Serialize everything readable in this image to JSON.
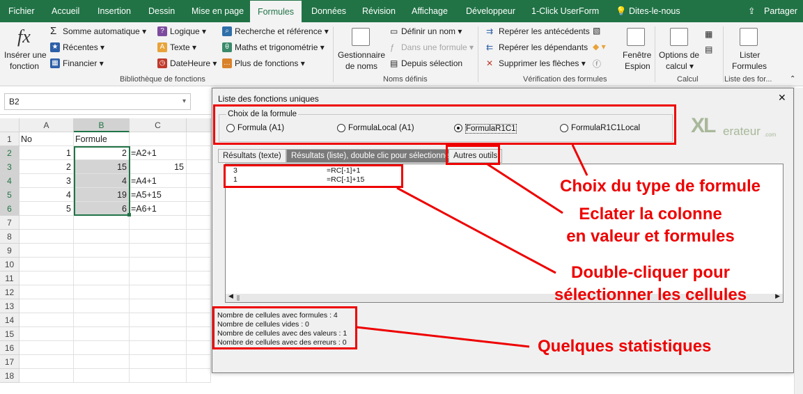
{
  "menu": {
    "tabs": [
      "Fichier",
      "Accueil",
      "Insertion",
      "Dessin",
      "Mise en page",
      "Formules",
      "Données",
      "Révision",
      "Affichage",
      "Développeur",
      "1-Click UserForm"
    ],
    "active_tab": "Formules",
    "search": "Dites-le-nous",
    "share": "Partager"
  },
  "ribbon": {
    "insert_function": [
      "Insérer une",
      "fonction"
    ],
    "library": [
      "Somme automatique",
      "Récentes",
      "Financier",
      "Logique",
      "Texte",
      "DateHeure",
      "Recherche et référence",
      "Maths et trigonométrie",
      "Plus de fonctions"
    ],
    "library_label": "Bibliothèque de fonctions",
    "name_manager": [
      "Gestionnaire",
      "de noms"
    ],
    "names": [
      "Définir un nom",
      "Dans une formule",
      "Depuis sélection"
    ],
    "names_label": "Noms définis",
    "audit": [
      "Repérer les antécédents",
      "Repérer les dépendants",
      "Supprimer les flèches"
    ],
    "watch": [
      "Fenêtre",
      "Espion"
    ],
    "audit_label": "Vérification des formules",
    "calc_options": [
      "Options de",
      "calcul"
    ],
    "calc_label": "Calcul",
    "list_formulas": [
      "Lister",
      "Formules"
    ],
    "list_label": "Liste des for..."
  },
  "namebox": "B2",
  "sheet": {
    "columns": [
      "A",
      "B",
      "C"
    ],
    "rows": [
      "1",
      "2",
      "3",
      "4",
      "5",
      "6",
      "7",
      "8",
      "9",
      "10",
      "11",
      "12",
      "13",
      "14",
      "15",
      "16",
      "17",
      "18"
    ],
    "cells": [
      [
        "No",
        "Formule",
        ""
      ],
      [
        "1",
        "2",
        "=A2+1"
      ],
      [
        "2",
        "15",
        "15"
      ],
      [
        "3",
        "4",
        "=A4+1"
      ],
      [
        "4",
        "19",
        "=A5+15"
      ],
      [
        "5",
        "6",
        "=A6+1"
      ]
    ]
  },
  "dialog": {
    "title": "Liste des fonctions uniques",
    "close": "✕",
    "group_title": "Choix de la formule",
    "radios": [
      "Formula (A1)",
      "FormulaLocal (A1)",
      "FormulaR1C1",
      "FormulaR1C1Local"
    ],
    "selected_radio": "FormulaR1C1",
    "logo": [
      "XL",
      "erateur",
      ".com"
    ],
    "tabs": [
      "Résultats (texte)",
      "Résultats (liste), double clic pour sélectionner",
      "Autres outils"
    ],
    "active_tab": "Résultats (liste), double clic pour sélectionner",
    "results": [
      [
        "3",
        "=RC[-1]+1"
      ],
      [
        "1",
        "=RC[-1]+15"
      ]
    ],
    "stats": [
      "Nombre de cellules avec formules : 4",
      "Nombre de cellules vides : 0",
      "Nombre de cellules avec des valeurs : 1",
      "Nombre de cellules avec des erreurs : 0"
    ]
  },
  "annotations": {
    "formula_type": "Choix du type de formule",
    "explode": [
      "Eclater la colonne",
      "en valeur et formules"
    ],
    "double_click": [
      "Double-cliquer pour",
      "sélectionner les cellules"
    ],
    "stats": "Quelques statistiques"
  },
  "colors": {
    "excel_green": "#217346",
    "annotation_red": "#e00000"
  }
}
